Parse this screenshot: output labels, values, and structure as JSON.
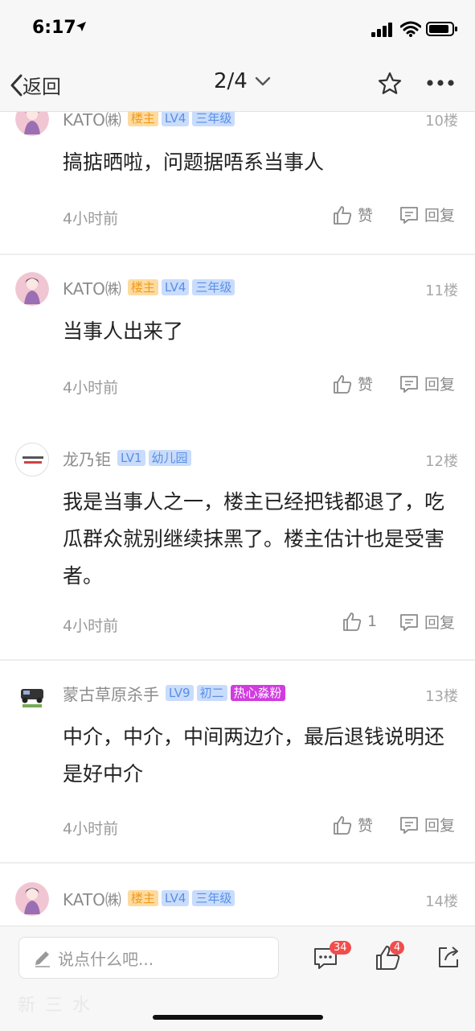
{
  "status_bar": {
    "time": "6:17"
  },
  "nav": {
    "back_label": "返回",
    "page_indicator": "2/4"
  },
  "posts": [
    {
      "username": "KATO㈱",
      "badges": [
        "楼主",
        "LV4",
        "三年级"
      ],
      "floor": "10楼",
      "content": "搞掂晒啦，问题据唔系当事人",
      "time": "4小时前",
      "like_label": "赞",
      "reply_label": "回复"
    },
    {
      "username": "KATO㈱",
      "badges": [
        "楼主",
        "LV4",
        "三年级"
      ],
      "floor": "11楼",
      "content": "当事人出来了",
      "time": "4小时前",
      "like_label": "赞",
      "reply_label": "回复"
    },
    {
      "username": "龙乃钜",
      "badges": [
        "LV1",
        "幼儿园"
      ],
      "floor": "12楼",
      "content": "我是当事人之一，楼主已经把钱都退了，吃瓜群众就别继续抹黑了。楼主估计也是受害者。",
      "time": "4小时前",
      "like_label": "1",
      "reply_label": "回复"
    },
    {
      "username": "蒙古草原杀手",
      "badges": [
        "LV9",
        "初二",
        "热心淼粉"
      ],
      "floor": "13楼",
      "content": "中介，中介，中间两边介，最后退钱说明还是好中介",
      "time": "4小时前",
      "like_label": "赞",
      "reply_label": "回复"
    },
    {
      "username": "KATO㈱",
      "badges": [
        "楼主",
        "LV4",
        "三年级"
      ],
      "floor": "14楼"
    }
  ],
  "bottom_bar": {
    "input_placeholder": "说点什么吧...",
    "comment_count": "34",
    "like_count": "4",
    "watermark": "新三水"
  }
}
